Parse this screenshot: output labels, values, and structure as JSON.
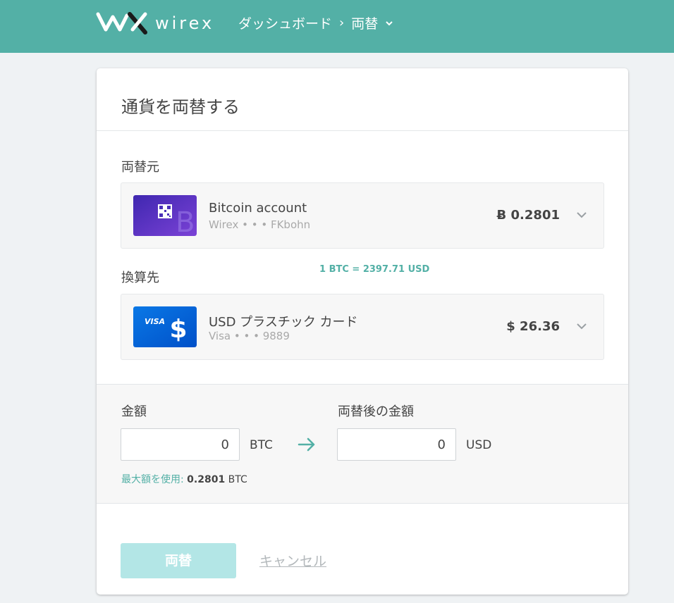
{
  "header": {
    "logo_text": "wirex",
    "breadcrumb_dashboard": "ダッシュボード",
    "breadcrumb_separator": "›",
    "breadcrumb_current": "両替",
    "breadcrumb_chevron": "⌄"
  },
  "card": {
    "title": "通貨を両替する",
    "from_label": "両替元",
    "to_label": "換算先",
    "rate": "1 BTC = 2397.71 USD"
  },
  "from_account": {
    "name": "Bitcoin account",
    "sub": "Wirex • • • FKbohn",
    "balance": "Ƀ 0.2801",
    "card_icon": "bitcoin-card-icon"
  },
  "to_account": {
    "name": "USD プラスチック カード",
    "sub": "Visa • • • 9889",
    "balance": "$ 26.36",
    "card_brand": "VISA",
    "card_icon": "visa-dollar-card-icon"
  },
  "amount": {
    "label": "金額",
    "value": "0",
    "currency": "BTC",
    "result_label": "両替後の金額",
    "result_value": "0",
    "result_currency": "USD",
    "max_link": "最大額を使用:",
    "max_value": "0.2801",
    "max_currency": "BTC"
  },
  "actions": {
    "exchange": "両替",
    "cancel": "キャンセル"
  },
  "colors": {
    "brand": "#53b0a6",
    "button_disabled": "#b3e6e6",
    "page_bg": "#eff2f4"
  }
}
